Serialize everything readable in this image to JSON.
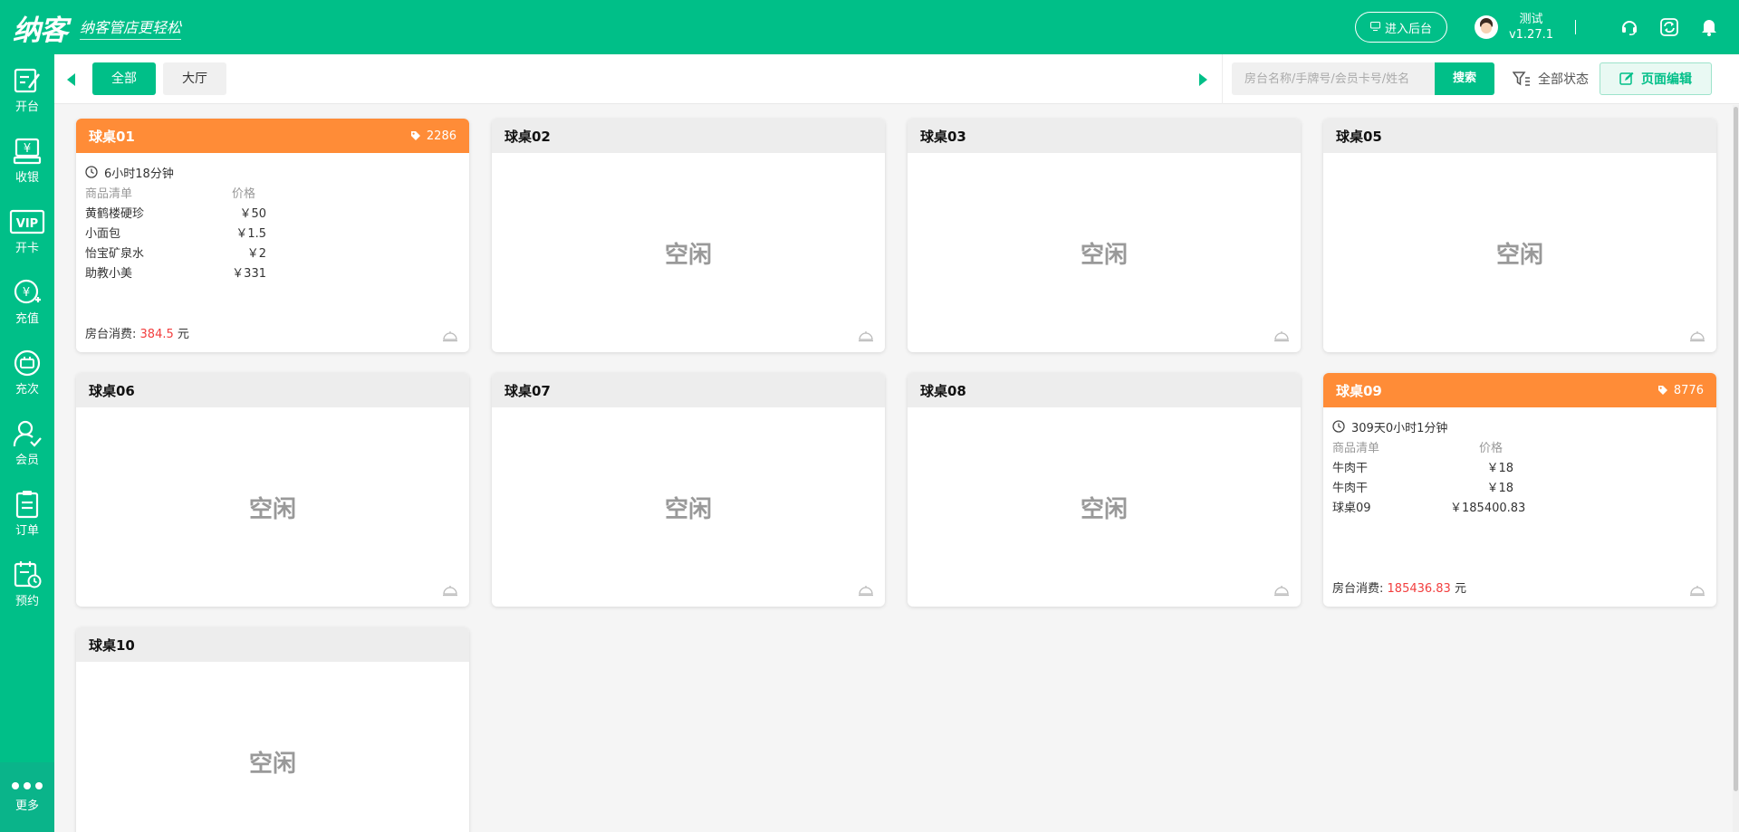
{
  "header": {
    "logo_text": "纳客",
    "slogan": "纳客管店更轻松",
    "backend_button": "进入后台",
    "user_name": "测试",
    "version": "v1.27.1",
    "divider": "|"
  },
  "sidebar": {
    "items": [
      {
        "label": "开台",
        "icon": "open-table-icon"
      },
      {
        "label": "收银",
        "icon": "cashier-icon"
      },
      {
        "label": "开卡",
        "icon": "vip-card-icon"
      },
      {
        "label": "充值",
        "icon": "recharge-icon"
      },
      {
        "label": "充次",
        "icon": "recharge-times-icon"
      },
      {
        "label": "会员",
        "icon": "member-icon"
      },
      {
        "label": "订单",
        "icon": "order-icon"
      },
      {
        "label": "预约",
        "icon": "reservation-icon"
      }
    ],
    "more_label": "更多"
  },
  "tabs": {
    "items": [
      "全部",
      "大厅"
    ],
    "active": "全部"
  },
  "search": {
    "placeholder": "房台名称/手牌号/会员卡号/姓名",
    "button": "搜索"
  },
  "filter": {
    "label": "全部状态"
  },
  "edit_button": {
    "label": "页面编辑"
  },
  "common": {
    "goods_header": "商品清单",
    "price_header": "价格",
    "consume_label": "房台消费:",
    "consume_unit": "元",
    "idle_text": "空闲"
  },
  "cards": [
    {
      "name": "球桌01",
      "status": "busy",
      "tag": "2286",
      "duration": "6小时18分钟",
      "goods": [
        {
          "name": "黄鹤楼硬珍",
          "price": "￥50"
        },
        {
          "name": "小面包",
          "price": "￥1.5"
        },
        {
          "name": "怡宝矿泉水",
          "price": "￥2"
        },
        {
          "name": "助教小美",
          "price": "￥331"
        }
      ],
      "consume": "384.5"
    },
    {
      "name": "球桌02",
      "status": "idle"
    },
    {
      "name": "球桌03",
      "status": "idle"
    },
    {
      "name": "球桌05",
      "status": "idle"
    },
    {
      "name": "球桌06",
      "status": "idle"
    },
    {
      "name": "球桌07",
      "status": "idle"
    },
    {
      "name": "球桌08",
      "status": "idle"
    },
    {
      "name": "球桌09",
      "status": "busy",
      "tag": "8776",
      "duration": "309天0小时1分钟",
      "goods": [
        {
          "name": "牛肉干",
          "price": "￥18"
        },
        {
          "name": "牛肉干",
          "price": "￥18"
        },
        {
          "name": "球桌09",
          "price": "￥185400.83"
        }
      ],
      "consume": "185436.83"
    },
    {
      "name": "球桌10",
      "status": "idle"
    }
  ],
  "colors": {
    "brand": "#00bf88",
    "busy_header": "#ff8c37",
    "amount": "#f23e3e"
  }
}
